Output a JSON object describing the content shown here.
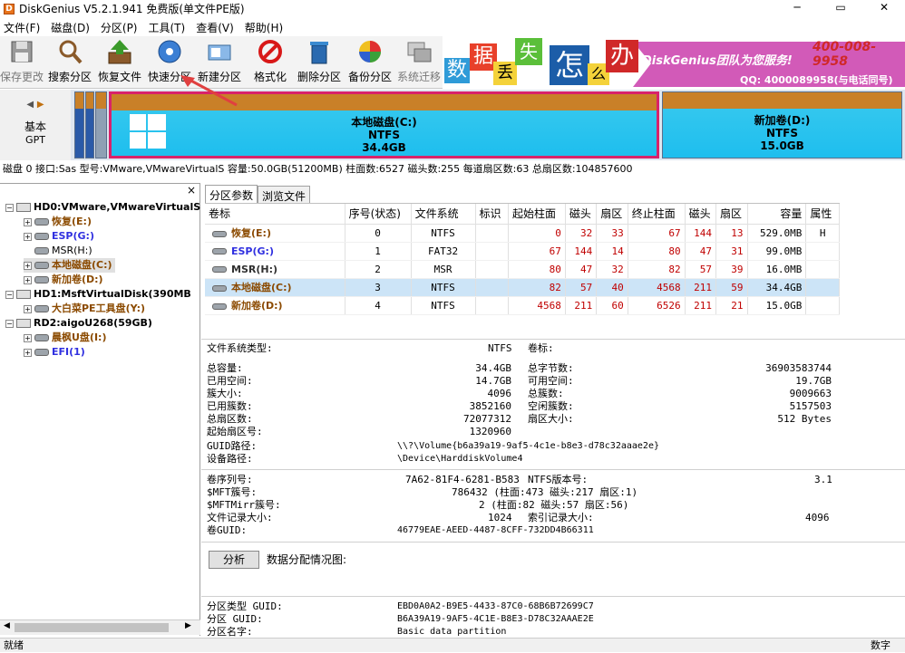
{
  "window": {
    "title": "DiskGenius V5.2.1.941 免费版(单文件PE版)",
    "minimize": "─",
    "restore": "▭",
    "close": "✕"
  },
  "menu": [
    "文件(F)",
    "磁盘(D)",
    "分区(P)",
    "工具(T)",
    "查看(V)",
    "帮助(H)"
  ],
  "toolbar": [
    {
      "label": "保存更改",
      "icon": "save-icon"
    },
    {
      "label": "搜索分区",
      "icon": "search-icon"
    },
    {
      "label": "恢复文件",
      "icon": "recover-icon"
    },
    {
      "label": "快速分区",
      "icon": "quick-partition-icon"
    },
    {
      "label": "新建分区",
      "icon": "new-partition-icon"
    },
    {
      "label": "格式化",
      "icon": "format-icon"
    },
    {
      "label": "删除分区",
      "icon": "delete-icon"
    },
    {
      "label": "备份分区",
      "icon": "backup-icon"
    },
    {
      "label": "系统迁移",
      "icon": "migrate-icon"
    }
  ],
  "banner": {
    "chars": [
      "数",
      "据",
      "丢",
      "失",
      "怎",
      "么",
      "办"
    ],
    "tagline": "DiskGenius团队为您服务!",
    "phone": "400-008-9958",
    "qq": "QQ: 4000089958(与电话同号)"
  },
  "diskmap": {
    "type_label": "基本",
    "scheme": "GPT",
    "prev": "◀",
    "next": "▶",
    "partitions": [
      {
        "name": "本地磁盘(C:)",
        "fs": "NTFS",
        "size": "34.4GB"
      },
      {
        "name": "新加卷(D:)",
        "fs": "NTFS",
        "size": "15.0GB"
      }
    ]
  },
  "diskinfo": "磁盘 0 接口:Sas  型号:VMware,VMwareVirtualS  容量:50.0GB(51200MB)  柱面数:6527  磁头数:255  每道扇区数:63  总扇区数:104857600",
  "tree": {
    "disks": [
      {
        "label": "HD0:VMware,VMwareVirtualS",
        "parts": [
          {
            "label": "恢复(E:)",
            "color": "#8b4a00"
          },
          {
            "label": "ESP(G:)",
            "color": "#3030e0"
          },
          {
            "label": "MSR(H:)",
            "color": "#303030"
          },
          {
            "label": "本地磁盘(C:)",
            "color": "#8b4a00"
          },
          {
            "label": "新加卷(D:)",
            "color": "#8b4a00"
          }
        ]
      },
      {
        "label": "HD1:MsftVirtualDisk(390MB",
        "parts": [
          {
            "label": "大白菜PE工具盘(Y:)",
            "color": "#8b4a00"
          }
        ]
      },
      {
        "label": "RD2:aigoU268(59GB)",
        "parts": [
          {
            "label": "晨枫U盘(I:)",
            "color": "#8b4a00"
          },
          {
            "label": "EFI(1)",
            "color": "#3030e0"
          }
        ]
      }
    ],
    "close": "×"
  },
  "tabs": [
    "分区参数",
    "浏览文件"
  ],
  "table": {
    "headers": [
      "卷标",
      "序号(状态)",
      "文件系统",
      "标识",
      "起始柱面",
      "磁头",
      "扇区",
      "终止柱面",
      "磁头",
      "扇区",
      "容量",
      "属性"
    ],
    "rows": [
      {
        "label": "恢复(E:)",
        "color": "#8b4a00",
        "c": [
          "0",
          "NTFS",
          "",
          "0",
          "32",
          "33",
          "67",
          "144",
          "13",
          "529.0MB",
          "H"
        ]
      },
      {
        "label": "ESP(G:)",
        "color": "#3030e0",
        "c": [
          "1",
          "FAT32",
          "",
          "67",
          "144",
          "14",
          "80",
          "47",
          "31",
          "99.0MB",
          ""
        ]
      },
      {
        "label": "MSR(H:)",
        "color": "#303030",
        "c": [
          "2",
          "MSR",
          "",
          "80",
          "47",
          "32",
          "82",
          "57",
          "39",
          "16.0MB",
          ""
        ]
      },
      {
        "label": "本地磁盘(C:)",
        "color": "#8b4a00",
        "c": [
          "3",
          "NTFS",
          "",
          "82",
          "57",
          "40",
          "4568",
          "211",
          "59",
          "34.4GB",
          ""
        ]
      },
      {
        "label": "新加卷(D:)",
        "color": "#8b4a00",
        "c": [
          "4",
          "NTFS",
          "",
          "4568",
          "211",
          "60",
          "6526",
          "211",
          "21",
          "15.0GB",
          ""
        ]
      }
    ]
  },
  "details": {
    "fs_type_l": "文件系统类型:",
    "fs_type_v": "NTFS",
    "vol_label_l": "卷标:",
    "left": [
      [
        "总容量:",
        "34.4GB"
      ],
      [
        "已用空间:",
        "14.7GB"
      ],
      [
        "簇大小:",
        "4096"
      ],
      [
        "已用簇数:",
        "3852160"
      ],
      [
        "总扇区数:",
        "72077312"
      ],
      [
        "起始扇区号:",
        "1320960"
      ]
    ],
    "right": [
      [
        "总字节数:",
        "36903583744"
      ],
      [
        "可用空间:",
        "19.7GB"
      ],
      [
        "总簇数:",
        "9009663"
      ],
      [
        "空闲簇数:",
        "5157503"
      ],
      [
        "扇区大小:",
        "512 Bytes"
      ]
    ],
    "guid_path_l": "GUID路径:",
    "guid_path_v": "\\\\?\\Volume{b6a39a19-9af5-4c1e-b8e3-d78c32aaae2e}",
    "dev_path_l": "设备路径:",
    "dev_path_v": "\\Device\\HarddiskVolume4",
    "serial_l": "卷序列号:",
    "serial_v": "7A62-81F4-6281-B583",
    "ntfs_ver_l": "NTFS版本号:",
    "ntfs_ver_v": "3.1",
    "mft_l": "$MFT簇号:",
    "mft_v": "786432 (柱面:473 磁头:217 扇区:1)",
    "mftmirr_l": "$MFTMirr簇号:",
    "mftmirr_v": "2 (柱面:82 磁头:57 扇区:56)",
    "rec_l": "文件记录大小:",
    "rec_v": "1024",
    "idx_l": "索引记录大小:",
    "idx_v": "4096",
    "vguid_l": "卷GUID:",
    "vguid_v": "46779EAE-AEED-4487-8CFF-732DD4B66311",
    "analyze": "分析",
    "alloc": "数据分配情况图:",
    "ptype_l": "分区类型 GUID:",
    "ptype_v": "EBD0A0A2-B9E5-4433-87C0-68B6B72699C7",
    "pguid_l": "分区 GUID:",
    "pguid_v": "B6A39A19-9AF5-4C1E-B8E3-D78C32AAAE2E",
    "pname_l": "分区名字:",
    "pname_v": "Basic data partition"
  },
  "status": {
    "left": "就绪",
    "right": "数字"
  }
}
